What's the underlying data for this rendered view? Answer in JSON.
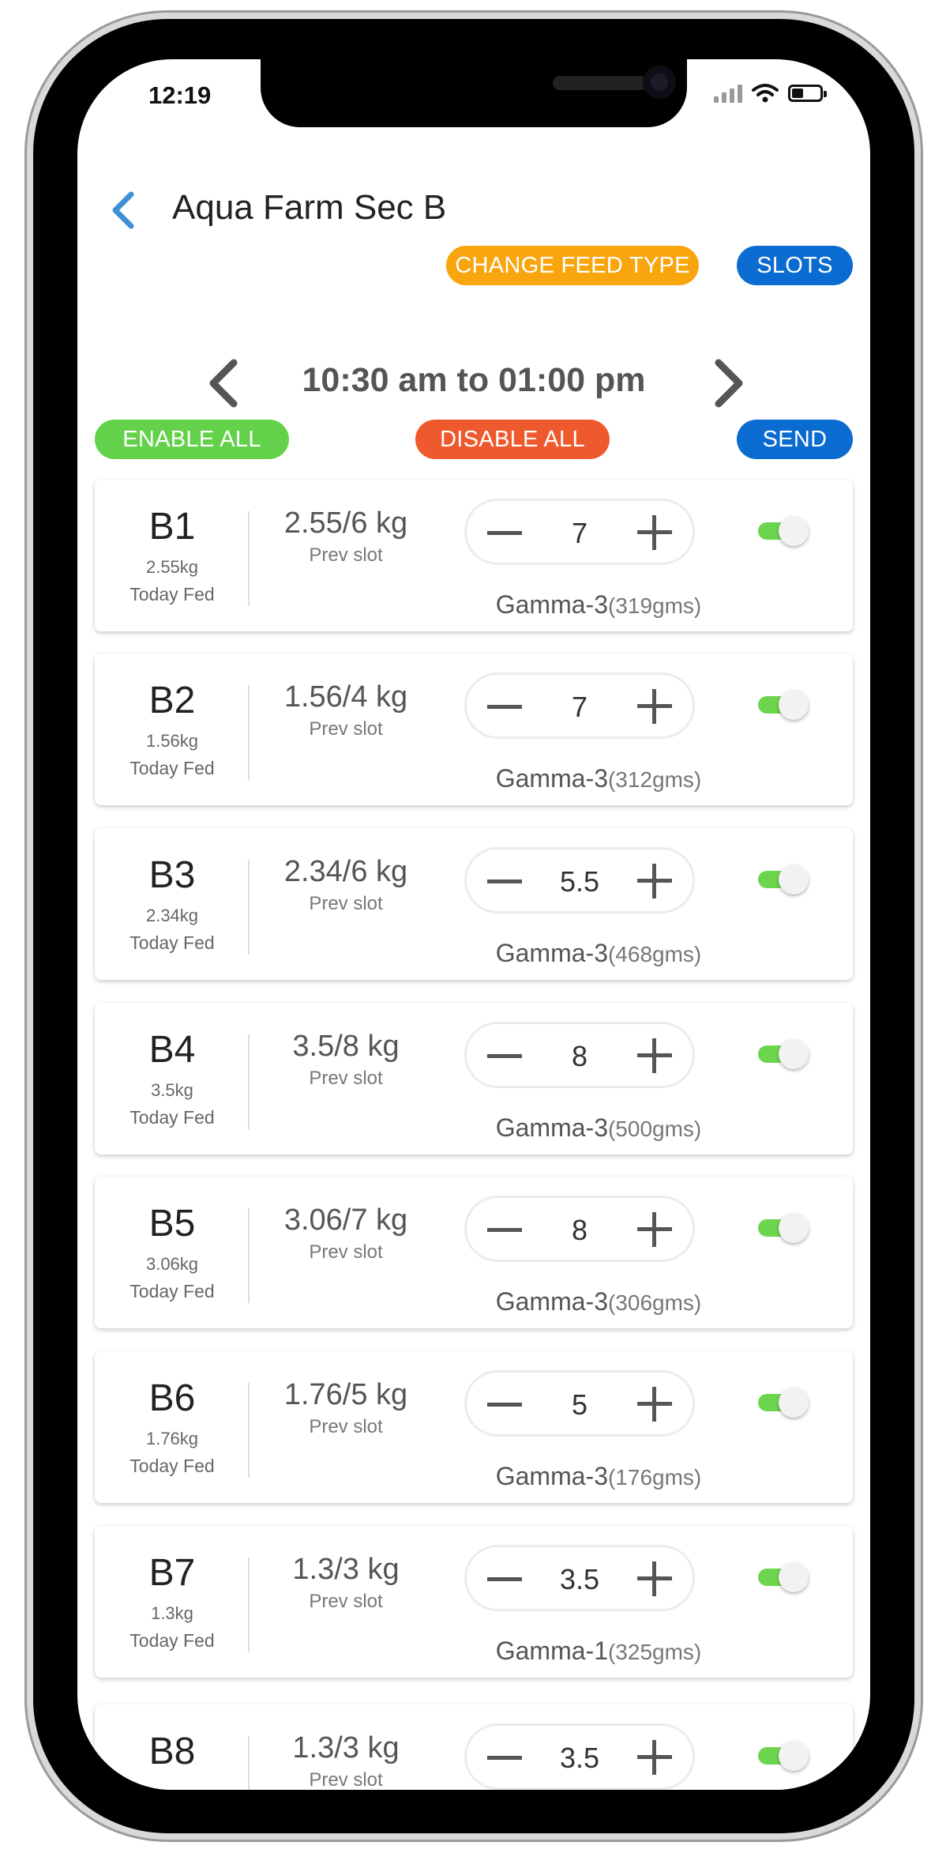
{
  "status_bar": {
    "time": "12:19"
  },
  "header": {
    "title": "Aqua Farm Sec B"
  },
  "actions": {
    "change_feed_type": "CHANGE FEED TYPE",
    "slots": "SLOTS",
    "enable_all": "ENABLE ALL",
    "disable_all": "DISABLE ALL",
    "send": "SEND"
  },
  "slot": {
    "label": "10:30 am to 01:00 pm"
  },
  "colors": {
    "orange": "#f9a50d",
    "blue": "#0a6bd1",
    "green": "#63d24a",
    "red_orange": "#ee5a2e",
    "back_arrow": "#3f8fd6"
  },
  "ponds": [
    {
      "name": "B1",
      "fed": "2.55kg",
      "fed_label": "Today Fed",
      "prev": "2.55/6 kg",
      "prev_label": "Prev slot",
      "qty": "7",
      "feed": "Gamma-3",
      "gms": "(319gms)",
      "enabled": true
    },
    {
      "name": "B2",
      "fed": "1.56kg",
      "fed_label": "Today Fed",
      "prev": "1.56/4 kg",
      "prev_label": "Prev slot",
      "qty": "7",
      "feed": "Gamma-3",
      "gms": "(312gms)",
      "enabled": true
    },
    {
      "name": "B3",
      "fed": "2.34kg",
      "fed_label": "Today Fed",
      "prev": "2.34/6 kg",
      "prev_label": "Prev slot",
      "qty": "5.5",
      "feed": "Gamma-3",
      "gms": "(468gms)",
      "enabled": true
    },
    {
      "name": "B4",
      "fed": "3.5kg",
      "fed_label": "Today Fed",
      "prev": "3.5/8 kg",
      "prev_label": "Prev slot",
      "qty": "8",
      "feed": "Gamma-3",
      "gms": "(500gms)",
      "enabled": true
    },
    {
      "name": "B5",
      "fed": "3.06kg",
      "fed_label": "Today Fed",
      "prev": "3.06/7 kg",
      "prev_label": "Prev slot",
      "qty": "8",
      "feed": "Gamma-3",
      "gms": "(306gms)",
      "enabled": true
    },
    {
      "name": "B6",
      "fed": "1.76kg",
      "fed_label": "Today Fed",
      "prev": "1.76/5 kg",
      "prev_label": "Prev slot",
      "qty": "5",
      "feed": "Gamma-3",
      "gms": "(176gms)",
      "enabled": true
    },
    {
      "name": "B7",
      "fed": "1.3kg",
      "fed_label": "Today Fed",
      "prev": "1.3/3 kg",
      "prev_label": "Prev slot",
      "qty": "3.5",
      "feed": "Gamma-1",
      "gms": "(325gms)",
      "enabled": true
    },
    {
      "name": "B8",
      "prev": "1.3/3 kg",
      "prev_label": "Prev slot",
      "qty": "3.5",
      "enabled": true
    }
  ]
}
